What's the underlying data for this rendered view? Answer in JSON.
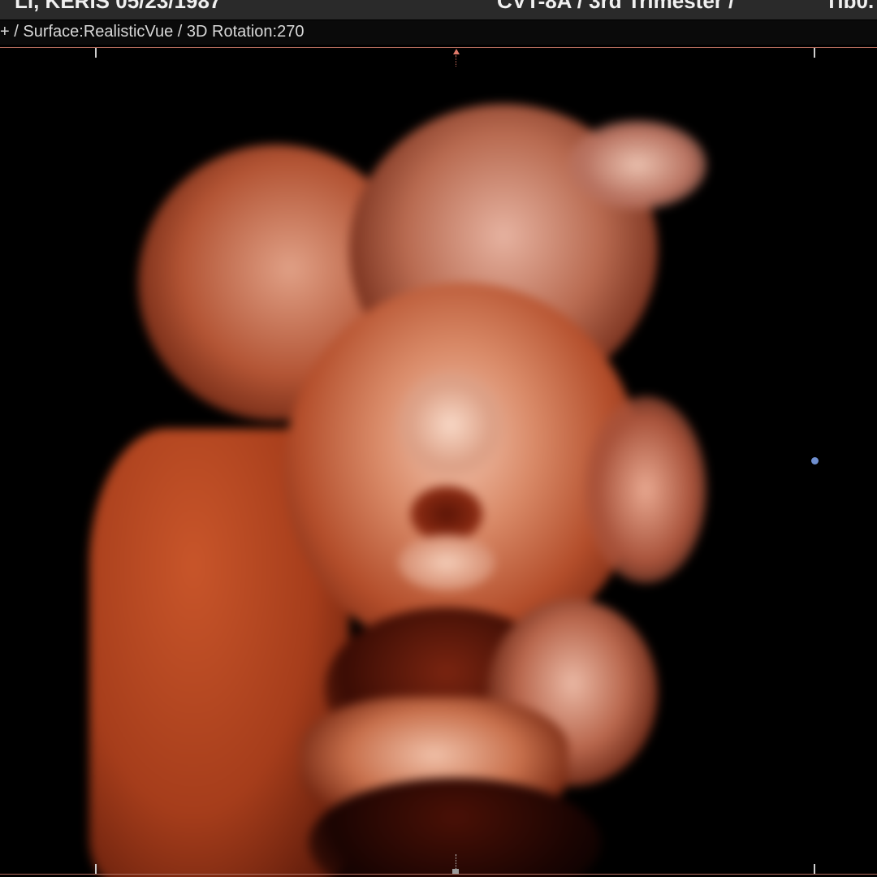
{
  "header": {
    "patient_label": "Li, KERIS 05/23/1987",
    "probe_label": "CVT-8A / 3rd Trimester /",
    "extra_label": "Tib0."
  },
  "settings": {
    "text": "+ / Surface:RealisticVue / 3D Rotation:270"
  },
  "viewport": {
    "render_mode": "3D surface rendering",
    "palette": {
      "background": "#000000",
      "skin_dark": "#6e1e0c",
      "skin_mid": "#b04a26",
      "skin_light": "#e8a58a",
      "highlight": "#f6d2c0",
      "frame_line": "#b06a5a",
      "side_marker": "#6f8fd0"
    },
    "icons": {
      "top_marker": "triangle-up-icon",
      "side_marker": "dot-icon"
    }
  }
}
